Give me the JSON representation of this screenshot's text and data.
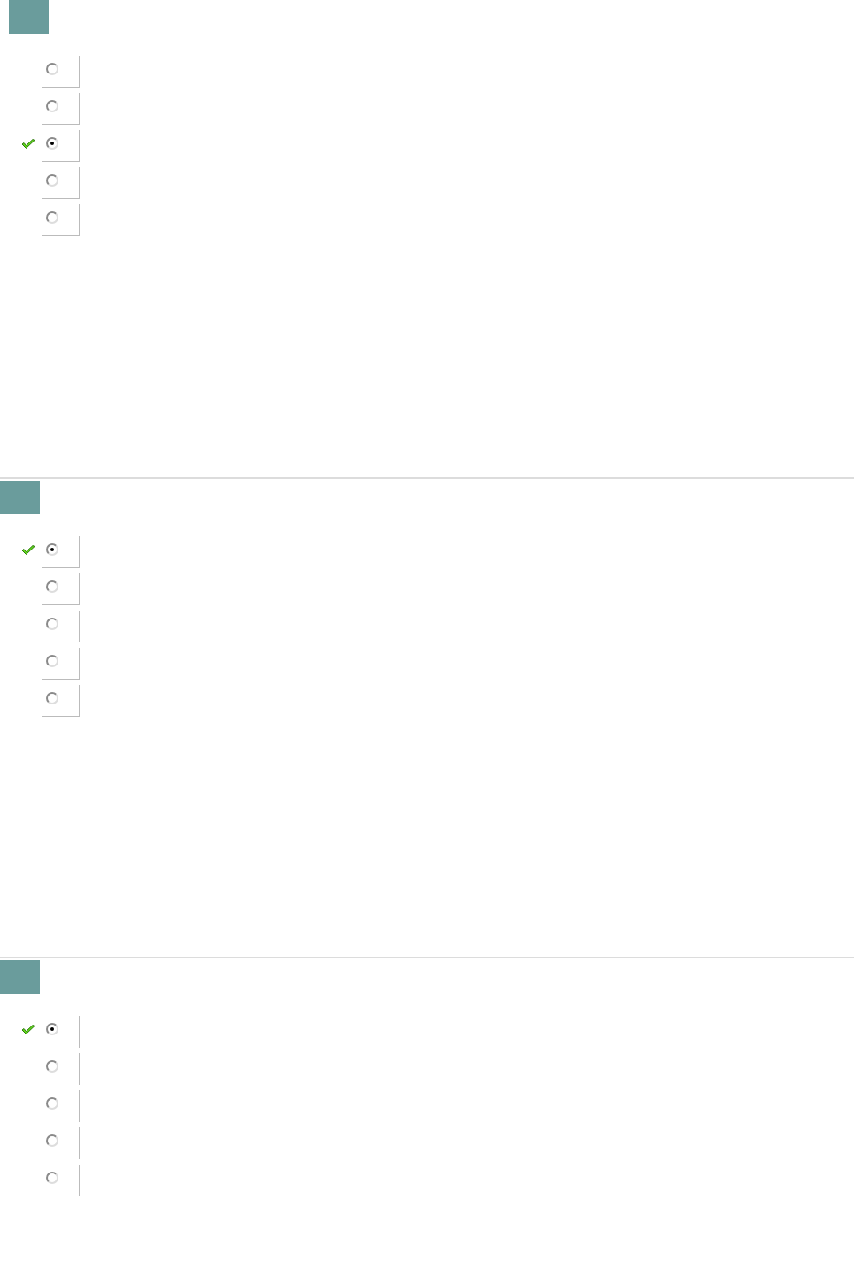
{
  "questions": [
    {
      "kind": "boxed",
      "options": [
        {
          "selected": false,
          "correct": false
        },
        {
          "selected": false,
          "correct": false
        },
        {
          "selected": true,
          "correct": true
        },
        {
          "selected": false,
          "correct": false
        },
        {
          "selected": false,
          "correct": false
        }
      ]
    },
    {
      "kind": "boxed",
      "options": [
        {
          "selected": true,
          "correct": true
        },
        {
          "selected": false,
          "correct": false
        },
        {
          "selected": false,
          "correct": false
        },
        {
          "selected": false,
          "correct": false
        },
        {
          "selected": false,
          "correct": false
        }
      ]
    },
    {
      "kind": "ruled",
      "options": [
        {
          "selected": true,
          "correct": true
        },
        {
          "selected": false,
          "correct": false
        },
        {
          "selected": false,
          "correct": false
        },
        {
          "selected": false,
          "correct": false
        },
        {
          "selected": false,
          "correct": false
        }
      ]
    }
  ]
}
